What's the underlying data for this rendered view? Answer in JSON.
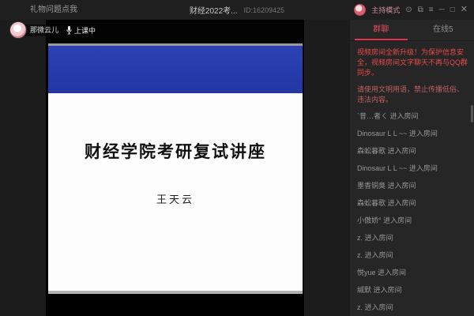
{
  "titlebar": {
    "gift_link": "礼物问题点我",
    "room_title": "财经2022考...",
    "room_id": "ID:16209425",
    "host_mode_label": "主持模式",
    "icons": {
      "settings": "⊙",
      "popout": "⧉",
      "menu": "≡",
      "minimize": "─",
      "maximize": "□",
      "close": "✕"
    }
  },
  "video": {
    "host_name": "那微云儿",
    "status_label": "上课中",
    "slide": {
      "title": "财经学院考研复试讲座",
      "speaker": "王天云"
    },
    "colors": {
      "slide_banner_blue": "#2236a4",
      "slide_background": "#fdfdfd"
    }
  },
  "sidebar": {
    "tabs": [
      {
        "label": "群聊",
        "active": true
      },
      {
        "label": "在线5",
        "active": false
      }
    ],
    "accent_red": "#e8334f",
    "announcements": [
      {
        "text": "视频房间全新升级！为保护信息安全，视频房间文字聊天不再与QQ群同步。",
        "color": "#e64a4a"
      },
      {
        "text": "请使用文明用语，禁止传播低俗、违法内容。",
        "color": "#c06060"
      }
    ],
    "messages": [
      "`昔…者ㄑ 进入房间",
      "Dinosaur L L ~~ 进入房间",
      "森蚣暮歌 进入房间",
      "Dinosaur L L ~~ 进入房间",
      "墨香铜臭 进入房间",
      "森蚣暮歌 进入房间",
      "小傲娇° 进入房间",
      "z. 进入房间",
      "z. 进入房间",
      "悦yue 进入房间",
      "缄默 进入房间",
      "z. 进入房间"
    ]
  }
}
